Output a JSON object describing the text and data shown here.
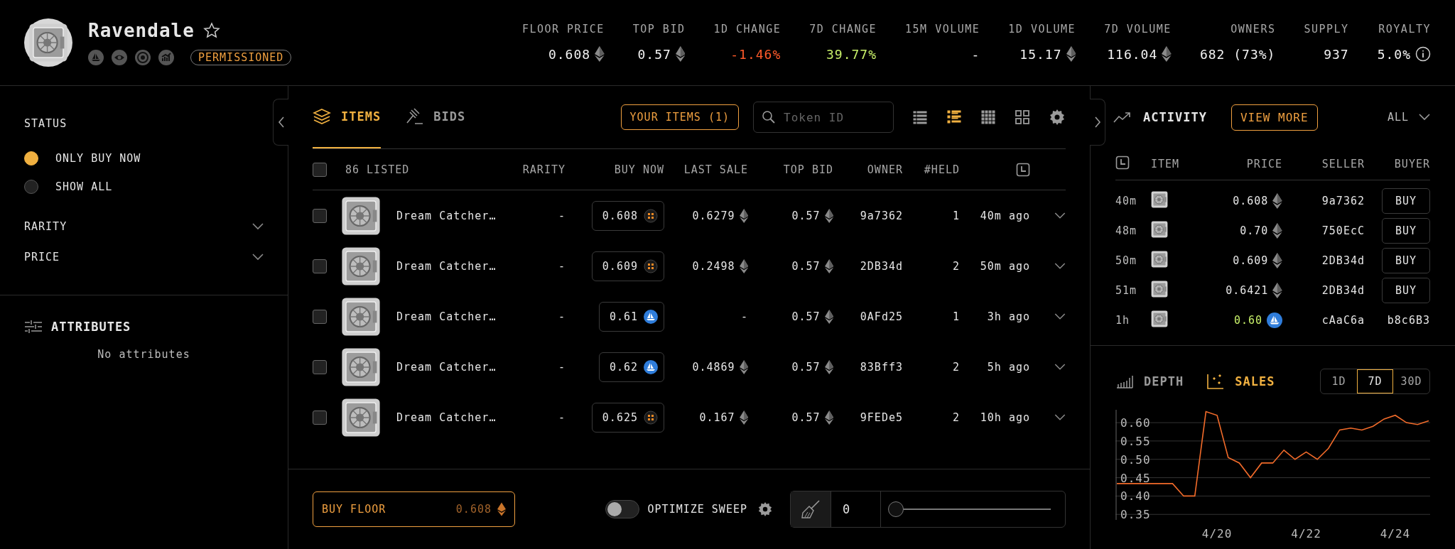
{
  "collection": {
    "name": "Ravendale",
    "favorited": false,
    "badge": "PERMISSIONED"
  },
  "stats": [
    {
      "label": "FLOOR PRICE",
      "value": "0.608",
      "eth": true,
      "info": false,
      "color": "#f2f2f2"
    },
    {
      "label": "TOP BID",
      "value": "0.57",
      "eth": true,
      "info": false,
      "color": "#f2f2f2"
    },
    {
      "label": "1D CHANGE",
      "value": "-1.46%",
      "eth": false,
      "info": false,
      "color": "#ff5a2a"
    },
    {
      "label": "7D CHANGE",
      "value": "39.77%",
      "eth": false,
      "info": false,
      "color": "#c8f06a"
    },
    {
      "label": "15M VOLUME",
      "value": "-",
      "eth": false,
      "info": false,
      "color": "#f2f2f2"
    },
    {
      "label": "1D VOLUME",
      "value": "15.17",
      "eth": true,
      "info": false,
      "color": "#f2f2f2"
    },
    {
      "label": "7D VOLUME",
      "value": "116.04",
      "eth": true,
      "info": false,
      "color": "#f2f2f2"
    },
    {
      "label": "OWNERS",
      "value": "682 (73%)",
      "eth": false,
      "info": false,
      "color": "#f2f2f2"
    },
    {
      "label": "SUPPLY",
      "value": "937",
      "eth": false,
      "info": false,
      "color": "#f2f2f2"
    },
    {
      "label": "ROYALTY",
      "value": "5.0%",
      "eth": false,
      "info": true,
      "color": "#f2f2f2"
    }
  ],
  "sidebar": {
    "status": {
      "title": "STATUS",
      "options": [
        {
          "label": "ONLY BUY NOW",
          "selected": true
        },
        {
          "label": "SHOW ALL",
          "selected": false
        }
      ]
    },
    "filters": [
      {
        "label": "RARITY",
        "expanded": false
      },
      {
        "label": "PRICE",
        "expanded": false
      }
    ],
    "attributes": {
      "title": "ATTRIBUTES",
      "empty_text": "No attributes"
    }
  },
  "items_panel": {
    "tabs": [
      {
        "label": "ITEMS",
        "kind": "items",
        "selected": true
      },
      {
        "label": "BIDS",
        "kind": "bids",
        "selected": false
      }
    ],
    "your_items_button": "YOUR ITEMS (1)",
    "search": {
      "placeholder": "Token ID"
    },
    "view_modes": [
      {
        "kind": "list",
        "selected": false
      },
      {
        "kind": "detailed",
        "selected": true
      },
      {
        "kind": "dense",
        "selected": false
      },
      {
        "kind": "grid",
        "selected": false
      }
    ],
    "table": {
      "select_all": {
        "checked": false
      },
      "columns": [
        "86 LISTED",
        "RARITY",
        "BUY NOW",
        "LAST SALE",
        "TOP BID",
        "OWNER",
        "#HELD"
      ],
      "rows": [
        {
          "kind": "coin",
          "checked": false,
          "name": "Dream Catcher…",
          "rarity": "-",
          "buy_now": "0.608",
          "last_sale": "0.6279",
          "top_bid": "0.57",
          "owner": "9a7362",
          "held": "1",
          "listed": "40m ago"
        },
        {
          "kind": "coin",
          "checked": false,
          "name": "Dream Catcher…",
          "rarity": "-",
          "buy_now": "0.609",
          "last_sale": "0.2498",
          "top_bid": "0.57",
          "owner": "2DB34d",
          "held": "2",
          "listed": "50m ago"
        },
        {
          "kind": "sailboat",
          "checked": false,
          "name": "Dream Catcher…",
          "rarity": "-",
          "buy_now": "0.61",
          "last_sale": "-",
          "top_bid": "0.57",
          "owner": "0AFd25",
          "held": "1",
          "listed": "3h ago"
        },
        {
          "kind": "sailboat",
          "checked": false,
          "name": "Dream Catcher…",
          "rarity": "-",
          "buy_now": "0.62",
          "last_sale": "0.4869",
          "top_bid": "0.57",
          "owner": "83Bff3",
          "held": "2",
          "listed": "5h ago"
        },
        {
          "kind": "coin",
          "checked": false,
          "name": "Dream Catcher…",
          "rarity": "-",
          "buy_now": "0.625",
          "last_sale": "0.167",
          "top_bid": "0.57",
          "owner": "9FEDe5",
          "held": "2",
          "listed": "10h ago"
        }
      ]
    },
    "footer": {
      "buy_floor": {
        "label": "BUY FLOOR",
        "price": "0.608"
      },
      "optimize_sweep": {
        "label": "OPTIMIZE SWEEP",
        "on": false
      },
      "sweep": {
        "value": "0",
        "level": 0
      }
    }
  },
  "activity": {
    "title": "ACTIVITY",
    "view_more": "VIEW MORE",
    "filter": "ALL",
    "columns": [
      "ITEM",
      "PRICE",
      "SELLER",
      "BUYER"
    ],
    "rows": [
      {
        "kind": "eth",
        "time": "40m",
        "price": "0.608",
        "highlight": false,
        "seller": "9a7362",
        "buyer": {
          "kind": "button",
          "label": "BUY"
        }
      },
      {
        "kind": "eth",
        "time": "48m",
        "price": "0.70",
        "highlight": false,
        "seller": "750EcC",
        "buyer": {
          "kind": "button",
          "label": "BUY"
        }
      },
      {
        "kind": "eth",
        "time": "50m",
        "price": "0.609",
        "highlight": false,
        "seller": "2DB34d",
        "buyer": {
          "kind": "button",
          "label": "BUY"
        }
      },
      {
        "kind": "eth",
        "time": "51m",
        "price": "0.6421",
        "highlight": false,
        "seller": "2DB34d",
        "buyer": {
          "kind": "button",
          "label": "BUY"
        }
      },
      {
        "kind": "sailboat",
        "time": "1h",
        "price": "0.60",
        "highlight": true,
        "seller": "cAaC6a",
        "buyer": {
          "kind": "address",
          "label": "b8c6B3"
        }
      }
    ]
  },
  "chart_panel": {
    "tabs": [
      {
        "label": "DEPTH",
        "kind": "depth",
        "selected": false
      },
      {
        "label": "SALES",
        "kind": "sales",
        "selected": true
      }
    ],
    "ranges": [
      {
        "label": "1D",
        "selected": false
      },
      {
        "label": "7D",
        "selected": true
      },
      {
        "label": "30D",
        "selected": false
      }
    ],
    "chart_data": {
      "type": "line",
      "categories": [
        null,
        null,
        null,
        null,
        null,
        null,
        null,
        null,
        null,
        "4/20",
        null,
        null,
        null,
        null,
        null,
        null,
        null,
        "4/22",
        null,
        null,
        null,
        null,
        null,
        null,
        null,
        "4/24",
        null,
        null,
        null
      ],
      "series": [
        {
          "color": "#f26b2a",
          "values": [
            0.434,
            0.434,
            0.434,
            0.434,
            0.434,
            0.434,
            0.4,
            0.4,
            0.63,
            0.62,
            0.505,
            0.49,
            0.45,
            0.49,
            0.49,
            0.525,
            0.5,
            0.52,
            0.5,
            0.53,
            0.58,
            0.585,
            0.58,
            0.59,
            0.61,
            0.62,
            0.6,
            0.595,
            0.605
          ]
        }
      ],
      "ylim": [
        0.335,
        0.635
      ],
      "grid": true,
      "yticks": [
        {
          "value": 0.35,
          "label": "0.35"
        },
        {
          "value": 0.4,
          "label": "0.40"
        },
        {
          "value": 0.45,
          "label": "0.45"
        },
        {
          "value": 0.5,
          "label": "0.50"
        },
        {
          "value": 0.55,
          "label": "0.55"
        },
        {
          "value": 0.6,
          "label": "0.60"
        }
      ]
    }
  }
}
